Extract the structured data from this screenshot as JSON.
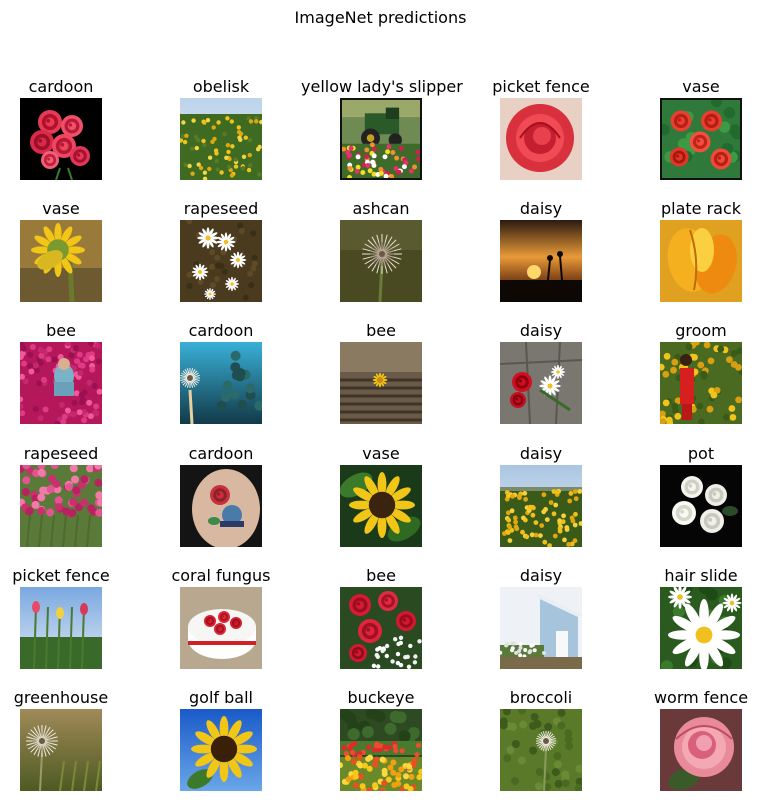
{
  "chart_data": {
    "type": "image_grid",
    "title": "ImageNet predictions",
    "rows": 6,
    "cols": 5,
    "cells": [
      {
        "label": "cardoon",
        "icon": "red-tulips-on-black-photo"
      },
      {
        "label": "obelisk",
        "icon": "sunflower-field-photo"
      },
      {
        "label": "yellow lady's slipper",
        "icon": "tractor-in-tulip-field-photo"
      },
      {
        "label": "picket fence",
        "icon": "red-rose-closeup-photo"
      },
      {
        "label": "vase",
        "icon": "red-tulips-bouquet-photo"
      },
      {
        "label": "vase",
        "icon": "sunflower-back-photo"
      },
      {
        "label": "rapeseed",
        "icon": "white-daisies-photo"
      },
      {
        "label": "ashcan",
        "icon": "dandelion-seedhead-photo"
      },
      {
        "label": "daisy",
        "icon": "sunset-silhouette-photo"
      },
      {
        "label": "plate rack",
        "icon": "orange-tulip-closeup-photo"
      },
      {
        "label": "bee",
        "icon": "girl-in-tulip-field-photo"
      },
      {
        "label": "cardoon",
        "icon": "dandelion-against-sky-photo"
      },
      {
        "label": "bee",
        "icon": "yellow-flower-on-wood-photo"
      },
      {
        "label": "daisy",
        "icon": "roses-on-stone-photo"
      },
      {
        "label": "groom",
        "icon": "woman-in-sunflowers-photo"
      },
      {
        "label": "rapeseed",
        "icon": "pink-tulips-photo"
      },
      {
        "label": "cardoon",
        "icon": "rose-tattoo-photo"
      },
      {
        "label": "vase",
        "icon": "sunflower-closeup-photo"
      },
      {
        "label": "daisy",
        "icon": "sunflower-field-horizon-photo"
      },
      {
        "label": "pot",
        "icon": "white-roses-on-black-photo"
      },
      {
        "label": "picket fence",
        "icon": "tulip-stems-sky-photo"
      },
      {
        "label": "coral fungus",
        "icon": "rose-cake-photo"
      },
      {
        "label": "bee",
        "icon": "red-roses-bouquet-photo"
      },
      {
        "label": "daisy",
        "icon": "blue-shed-garden-photo"
      },
      {
        "label": "hair slide",
        "icon": "white-daisy-closeup-photo"
      },
      {
        "label": "greenhouse",
        "icon": "dandelion-clock-photo"
      },
      {
        "label": "golf ball",
        "icon": "sunflower-blue-sky-photo"
      },
      {
        "label": "buckeye",
        "icon": "tulip-rows-park-photo"
      },
      {
        "label": "broccoli",
        "icon": "dandelion-in-grass-photo"
      },
      {
        "label": "worm fence",
        "icon": "pink-rose-photo"
      }
    ]
  }
}
